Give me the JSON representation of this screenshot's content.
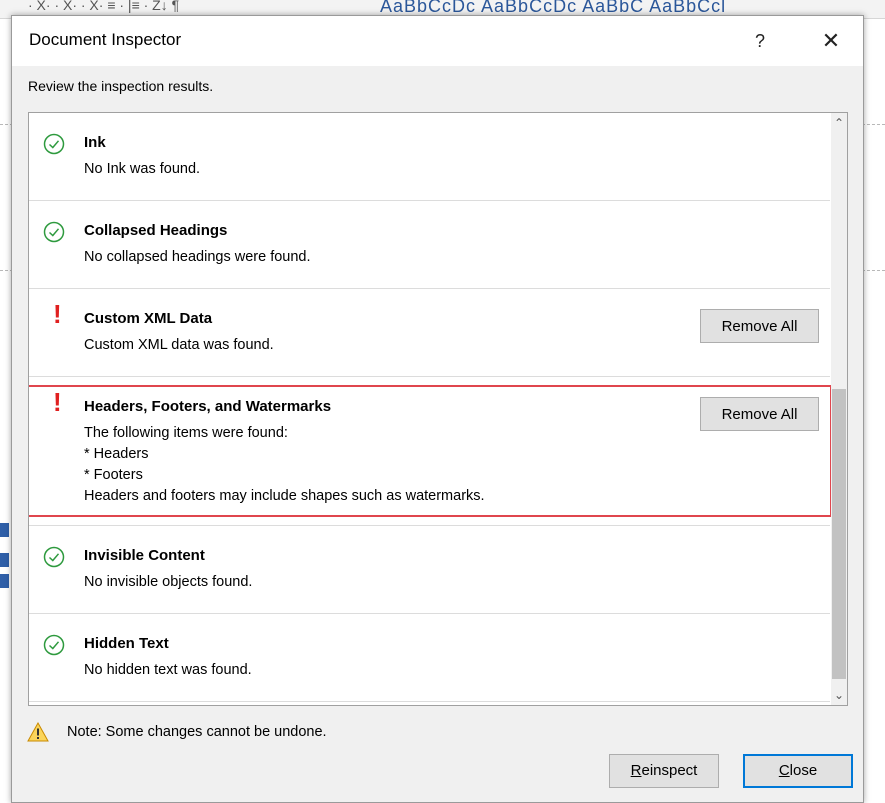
{
  "background": {
    "ribbon_styles": "AaBbCcDc  AaBbCcDc  AaBbC  AaBbCcl",
    "ribbon_fragment": "· X·  · X· · X·   ≡ · |≡ · Z↓  ¶"
  },
  "dialog": {
    "title": "Document Inspector",
    "help_label": "?",
    "close_label": "✕",
    "subtitle": "Review the inspection results.",
    "items": [
      {
        "status": "ok",
        "title": "Ink",
        "description": "No Ink was found."
      },
      {
        "status": "ok",
        "title": "Collapsed Headings",
        "description": "No collapsed headings were found."
      },
      {
        "status": "warning",
        "title": "Custom XML Data",
        "description": "Custom XML data was found.",
        "button": "Remove All"
      },
      {
        "status": "warning",
        "title": "Headers, Footers, and Watermarks",
        "description": "The following items were found:\n* Headers\n* Footers\nHeaders and footers may include shapes such as watermarks.",
        "button": "Remove All"
      },
      {
        "status": "ok",
        "title": "Invisible Content",
        "description": "No invisible objects found."
      },
      {
        "status": "ok",
        "title": "Hidden Text",
        "description": "No hidden text was found."
      }
    ],
    "note": "Note: Some changes cannot be undone.",
    "reinspect": {
      "mnemonic": "R",
      "rest": "einspect"
    },
    "close": {
      "mnemonic": "C",
      "rest": "lose"
    },
    "status_colors": {
      "ok": "#2e9a3e",
      "warning": "#e02020",
      "highlight": "#e0464e",
      "note_icon": "#f0b000"
    }
  }
}
